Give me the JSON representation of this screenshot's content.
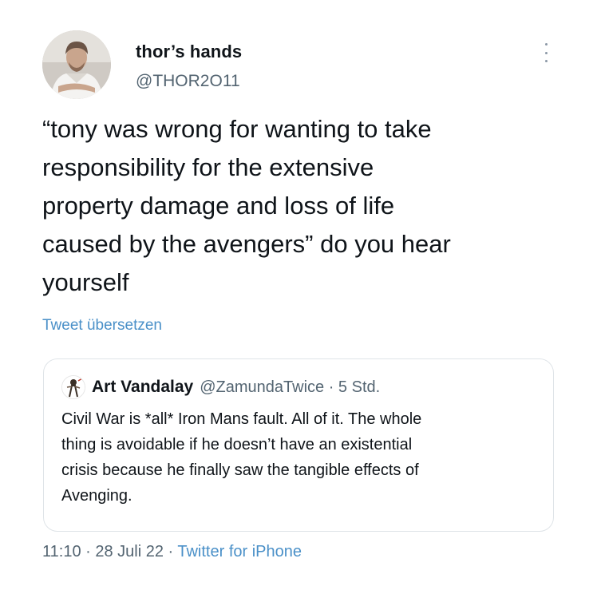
{
  "author": {
    "display_name": "thor’s hands",
    "handle": "@THOR2O11",
    "avatar_icon": "user-photo-avatar"
  },
  "tweet": {
    "text": "“tony was wrong for wanting to take\nresponsibility for the extensive\nproperty damage and loss of life\ncaused by the avengers” do you hear\nyourself",
    "translate_label": "Tweet übersetzen"
  },
  "quote": {
    "display_name": "Art Vandalay",
    "meta": "@ZamundaTwice · 5 Std.",
    "text": "Civil War is *all* Iron Mans fault. All of it. The whole\nthing is avoidable if he doesn’t have an existential\ncrisis because he finally saw the tangible effects of\nAvenging.",
    "avatar_icon": "sketch-avatar-icon"
  },
  "footer": {
    "timestamp": "11:10 · 28 Juli 22 · ",
    "source": "Twitter for iPhone"
  },
  "colors": {
    "text": "#0f1419",
    "secondary": "#536471",
    "link": "#4a90c8",
    "border": "#dfe4e8"
  },
  "icons": {
    "more": "more-dots-icon"
  }
}
